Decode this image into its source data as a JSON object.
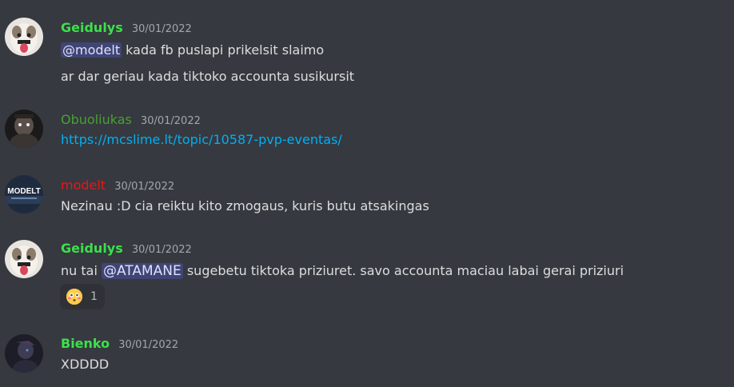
{
  "messages": [
    {
      "author": "Geidulys",
      "author_color": "#3be04b",
      "time": "30/01/2022",
      "avatar_icon": "white-dog-avatar-icon",
      "lines": [
        {
          "mention": "@modelt",
          "text": " kada fb puslapi prikelsit slaimo"
        },
        {
          "text": "ar dar geriau kada tiktoko accounta susikursit"
        }
      ]
    },
    {
      "author": "Obuoliukas",
      "author_color": "#46a134",
      "time": "30/01/2022",
      "avatar_icon": "dark-figure-avatar-icon",
      "lines": [
        {
          "link": "https://mcslime.lt/topic/10587-pvp-eventas/"
        }
      ]
    },
    {
      "author": "modelt",
      "author_color": "#e2191b",
      "time": "30/01/2022",
      "avatar_icon": "modelt-logo-avatar-icon",
      "avatar_text": "MODELT",
      "lines": [
        {
          "text": "Nezinau :D cia reiktu kito zmogaus, kuris butu atsakingas"
        }
      ]
    },
    {
      "author": "Geidulys",
      "author_color": "#3be04b",
      "time": "30/01/2022",
      "avatar_icon": "white-dog-avatar-icon",
      "lines": [
        {
          "before": "nu tai ",
          "mention": "@ATAMANE",
          "text": " sugebetu tiktoka priziuret. savo accounta maciau labai gerai priziuri"
        }
      ],
      "reaction": {
        "emoji": "flushed-face-icon",
        "count": "1"
      }
    },
    {
      "author": "Bienko",
      "author_color": "#3be04b",
      "time": "30/01/2022",
      "avatar_icon": "dark-anime-avatar-icon",
      "lines": [
        {
          "text": "XDDDD"
        }
      ]
    }
  ]
}
